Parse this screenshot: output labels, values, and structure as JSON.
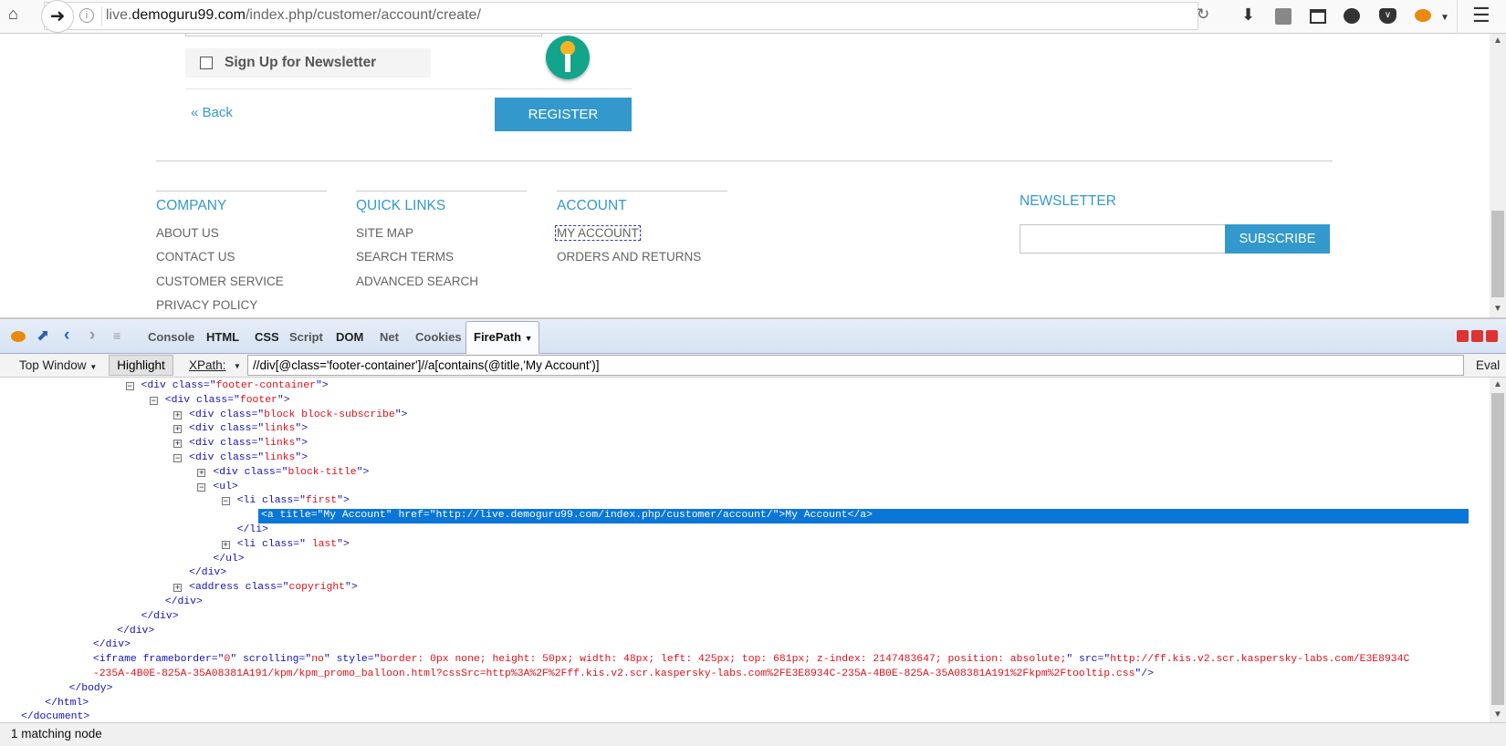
{
  "browser": {
    "url_prefix": "live.",
    "url_domain": "demoguru99.com",
    "url_path": "/index.php/customer/account/create/",
    "icons": [
      "home-icon",
      "back-icon",
      "info-icon",
      "reload-icon",
      "download-icon",
      "scratchpad-icon",
      "window-icon",
      "chat-icon",
      "pocket-icon",
      "firebug-icon",
      "menu-icon"
    ]
  },
  "page": {
    "newsletter_checkbox_label": "Sign Up for Newsletter",
    "newsletter_checked": false,
    "back_link": "« Back",
    "register_button": "REGISTER",
    "footer": {
      "columns": [
        {
          "title": "COMPANY",
          "links": [
            "ABOUT US",
            "CONTACT US",
            "CUSTOMER SERVICE",
            "PRIVACY POLICY"
          ]
        },
        {
          "title": "QUICK LINKS",
          "links": [
            "SITE MAP",
            "SEARCH TERMS",
            "ADVANCED SEARCH"
          ]
        },
        {
          "title": "ACCOUNT",
          "links": [
            "MY ACCOUNT",
            "ORDERS AND RETURNS"
          ]
        }
      ],
      "newsletter_title": "NEWSLETTER",
      "newsletter_input_value": "",
      "subscribe_button": "SUBSCRIBE"
    }
  },
  "devtools": {
    "tabs": [
      "Console",
      "HTML",
      "CSS",
      "Script",
      "DOM",
      "Net",
      "Cookies"
    ],
    "active_tab": "FirePath",
    "toolbar": {
      "frame_select": "Top Window",
      "highlight_button": "Highlight",
      "xpath_label": "XPath:",
      "xpath_value": "//div[@class='footer-container']//a[contains(@title,'My Account')]",
      "eval_button": "Eval"
    },
    "tree": [
      {
        "depth": 5,
        "exp": "-",
        "tag": "div",
        "attrs": [
          [
            "class",
            "footer-container"
          ]
        ]
      },
      {
        "depth": 6,
        "exp": "-",
        "tag": "div",
        "attrs": [
          [
            "class",
            "footer"
          ]
        ]
      },
      {
        "depth": 7,
        "exp": "+",
        "tag": "div",
        "attrs": [
          [
            "class",
            "block block-subscribe"
          ]
        ]
      },
      {
        "depth": 7,
        "exp": "+",
        "tag": "div",
        "attrs": [
          [
            "class",
            "links"
          ]
        ]
      },
      {
        "depth": 7,
        "exp": "+",
        "tag": "div",
        "attrs": [
          [
            "class",
            "links"
          ]
        ]
      },
      {
        "depth": 7,
        "exp": "-",
        "tag": "div",
        "attrs": [
          [
            "class",
            "links"
          ]
        ]
      },
      {
        "depth": 8,
        "exp": "+",
        "tag": "div",
        "attrs": [
          [
            "class",
            "block-title"
          ]
        ]
      },
      {
        "depth": 8,
        "exp": "-",
        "tag": "ul",
        "attrs": []
      },
      {
        "depth": 9,
        "exp": "-",
        "tag": "li",
        "attrs": [
          [
            "class",
            "first"
          ]
        ]
      },
      {
        "depth": 10,
        "selected": true,
        "tag": "a",
        "attrs": [
          [
            "title",
            "My Account"
          ],
          [
            "href",
            "http://live.demoguru99.com/index.php/customer/account/"
          ]
        ],
        "text": "My Account"
      },
      {
        "depth": 9,
        "close": "li"
      },
      {
        "depth": 9,
        "exp": "+",
        "tag": "li",
        "attrs": [
          [
            "class",
            " last"
          ]
        ]
      },
      {
        "depth": 8,
        "close": "ul"
      },
      {
        "depth": 7,
        "close": "div"
      },
      {
        "depth": 7,
        "exp": "+",
        "tag": "address",
        "attrs": [
          [
            "class",
            "copyright"
          ]
        ]
      },
      {
        "depth": 6,
        "close": "div"
      },
      {
        "depth": 5,
        "close": "div"
      },
      {
        "depth": 4,
        "close": "div"
      },
      {
        "depth": 3,
        "close": "div"
      },
      {
        "depth": 3,
        "selfclose": true,
        "wrap": true,
        "tag": "iframe",
        "attrs": [
          [
            "frameborder",
            "0"
          ],
          [
            "scrolling",
            "no"
          ],
          [
            "style",
            "border: 0px none; height: 50px; width: 48px; left: 425px; top: 681px; z-index: 2147483647; position: absolute;"
          ],
          [
            "src",
            "http://ff.kis.v2.scr.kaspersky-labs.com/E3E8934C-235A-4B0E-825A-35A08381A191/kpm/kpm_promo_balloon.html?cssSrc=http%3A%2F%2Fff.kis.v2.scr.kaspersky-labs.com%2FE3E8934C-235A-4B0E-825A-35A08381A191%2Fkpm%2Ftooltip.css"
          ]
        ]
      },
      {
        "depth": 2,
        "close": "body"
      },
      {
        "depth": 1,
        "close": "html"
      },
      {
        "depth": 0,
        "close": "document"
      }
    ],
    "status": "1 matching node"
  }
}
